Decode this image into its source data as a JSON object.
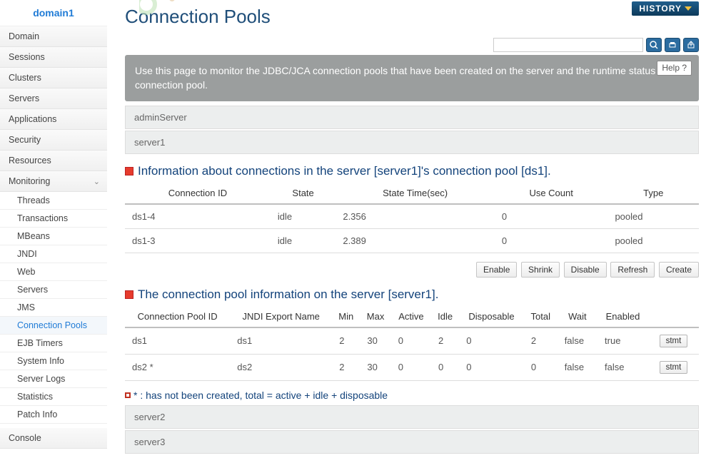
{
  "sidebar": {
    "title": "domain1",
    "items": [
      "Domain",
      "Sessions",
      "Clusters",
      "Servers",
      "Applications",
      "Security",
      "Resources"
    ],
    "monitoring_label": "Monitoring",
    "sub_items": [
      "Threads",
      "Transactions",
      "MBeans",
      "JNDI",
      "Web",
      "Servers",
      "JMS",
      "Connection Pools",
      "EJB Timers",
      "System Info",
      "Server Logs",
      "Statistics",
      "Patch Info"
    ],
    "console_label": "Console"
  },
  "header": {
    "title": "Connection Pools",
    "history_label": "HISTORY",
    "search_placeholder": ""
  },
  "banner": {
    "text": "Use this page to monitor the JDBC/JCA connection pools that have been created on the server and the runtime status of a connection pool.",
    "help_label": "Help  ?"
  },
  "servers": {
    "admin": "adminServer",
    "s1": "server1",
    "s2": "server2",
    "s3": "server3"
  },
  "section1": {
    "title": "Information about connections in the server [server1]'s connection pool [ds1].",
    "cols": [
      "Connection ID",
      "State",
      "State Time(sec)",
      "Use Count",
      "Type"
    ],
    "rows": [
      {
        "id": "ds1-4",
        "state": "idle",
        "time": "2.356",
        "use": "0",
        "type": "pooled"
      },
      {
        "id": "ds1-3",
        "state": "idle",
        "time": "2.389",
        "use": "0",
        "type": "pooled"
      }
    ]
  },
  "actions": {
    "enable": "Enable",
    "shrink": "Shrink",
    "disable": "Disable",
    "refresh": "Refresh",
    "create": "Create"
  },
  "section2": {
    "title": "The connection pool information on the server [server1].",
    "cols": [
      "Connection Pool ID",
      "JNDI Export Name",
      "Min",
      "Max",
      "Active",
      "Idle",
      "Disposable",
      "Total",
      "Wait",
      "Enabled"
    ],
    "rows": [
      {
        "pool": "ds1",
        "jndi": "ds1",
        "min": "2",
        "max": "30",
        "active": "0",
        "idle": "2",
        "disp": "0",
        "total": "2",
        "wait": "false",
        "enabled": "true",
        "stmt": "stmt"
      },
      {
        "pool": "ds2 *",
        "jndi": "ds2",
        "min": "2",
        "max": "30",
        "active": "0",
        "idle": "0",
        "disp": "0",
        "total": "0",
        "wait": "false",
        "enabled": "false",
        "stmt": "stmt"
      }
    ]
  },
  "footnote": "* : has not been created, total = active + idle + disposable"
}
